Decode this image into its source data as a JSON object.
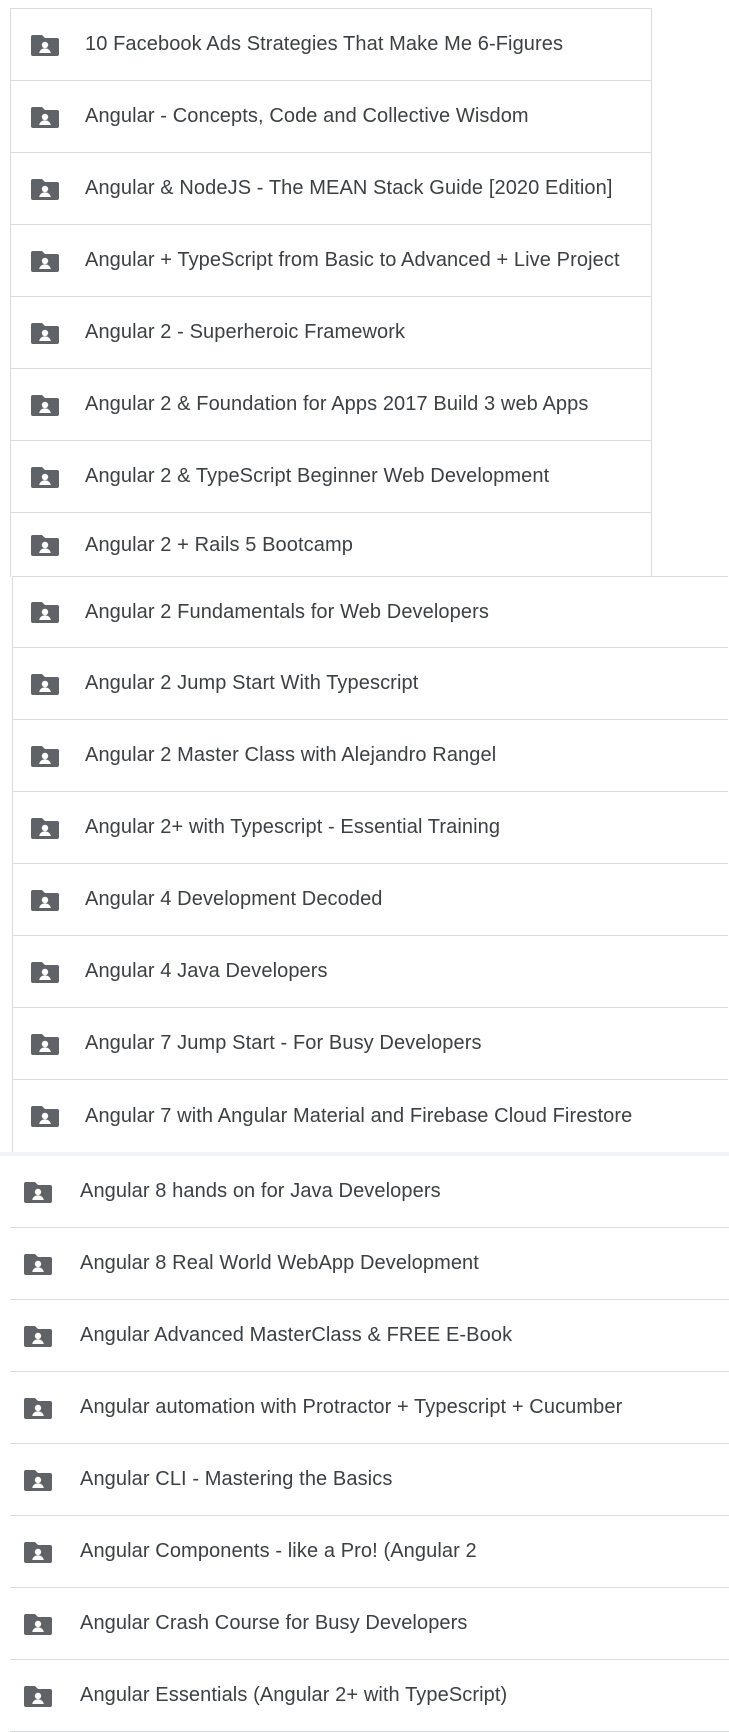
{
  "colors": {
    "icon": "#5f6368",
    "text": "#3c4043",
    "divider": "#dadce0"
  },
  "icon_name": "shared-folder-icon",
  "folders_a": [
    "10 Facebook Ads Strategies That Make Me 6-Figures",
    "Angular - Concepts, Code and Collective Wisdom",
    "Angular & NodeJS - The MEAN Stack Guide [2020 Edition]",
    "Angular + TypeScript from Basic to Advanced + Live Project",
    "Angular 2 - Superheroic Framework",
    "Angular 2 & Foundation for Apps 2017  Build 3 web Apps",
    "Angular 2 & TypeScript Beginner Web Development",
    "Angular 2 + Rails 5 Bootcamp"
  ],
  "folders_b": [
    "Angular 2 Fundamentals for Web Developers",
    "Angular 2 Jump Start With Typescript",
    "Angular 2 Master Class with Alejandro Rangel",
    "Angular 2+ with Typescript - Essential Training",
    "Angular 4 Development Decoded",
    "Angular 4 Java Developers",
    "Angular 7 Jump Start - For Busy Developers",
    "Angular 7 with Angular Material and Firebase Cloud Firestore"
  ],
  "folders_c": [
    "Angular 8 hands on for Java Developers",
    "Angular 8 Real World WebApp Development",
    "Angular Advanced MasterClass & FREE E-Book",
    "Angular automation with Protractor + Typescript + Cucumber",
    "Angular CLI - Mastering the Basics",
    "Angular Components - like a Pro! (Angular 2",
    "Angular Crash Course for Busy Developers",
    "Angular Essentials (Angular 2+ with TypeScript)"
  ]
}
